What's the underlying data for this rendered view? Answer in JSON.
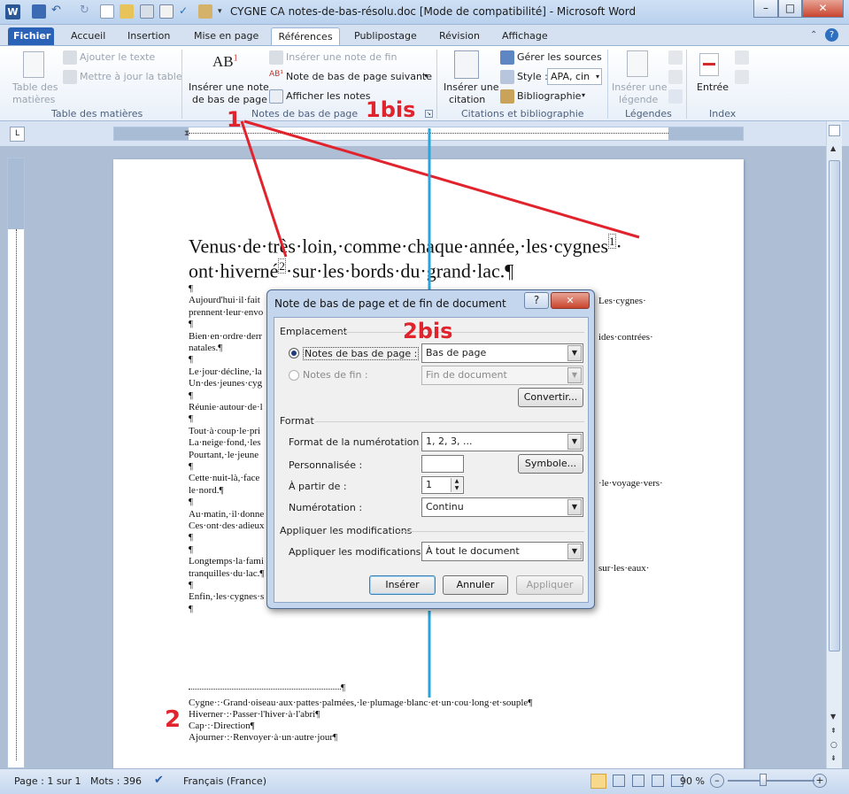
{
  "window": {
    "title": "CYGNE CA notes-de-bas-résolu.doc [Mode de compatibilité]  -  Microsoft Word",
    "minimize": "–",
    "maximize": "□",
    "close": "✕"
  },
  "tabs": [
    "Fichier",
    "Accueil",
    "Insertion",
    "Mise en page",
    "Références",
    "Publipostage",
    "Révision",
    "Affichage"
  ],
  "ribbon": {
    "toc": {
      "big_line1": "Table des",
      "big_line2": "matières",
      "add_text": "Ajouter le texte",
      "update": "Mettre à jour la table",
      "group": "Table des matières"
    },
    "notes": {
      "big_line1": "Insérer une note",
      "big_line2": "de bas de page",
      "ab_label": "AB",
      "ab_sup": "1",
      "insert_endnote": "Insérer une note de fin",
      "next_note": "Note de bas de page suivante",
      "show_notes": "Afficher les notes",
      "group": "Notes de bas de page"
    },
    "citations": {
      "big_line1": "Insérer une",
      "big_line2": "citation",
      "manage": "Gérer les sources",
      "style_label": "Style :",
      "style_value": "APA, cin",
      "biblio": "Bibliographie",
      "group": "Citations et bibliographie"
    },
    "captions": {
      "big_line1": "Insérer une",
      "big_line2": "légende",
      "group": "Légendes"
    },
    "index": {
      "big": "Entrée",
      "group": "Index"
    }
  },
  "document": {
    "line1": "Venus·de·très·loin,·comme·chaque·année,·les·cygnes",
    "sup1": "1",
    "line1_end": "·",
    "line2a": "ont·hiverné",
    "sup2": "2",
    "line2b": "·sur·les·bords·du·grand·lac.¶",
    "left_lines": [
      "¶",
      "Aujourd'hui·il·fait",
      "prennent·leur·envo",
      "¶",
      "Bien·en·ordre·derr",
      "natales.¶",
      "¶",
      "Le·jour·décline,·la",
      "Un·des·jeunes·cyg",
      "¶",
      "Réunie·autour·de·l",
      "¶",
      "Tout·à·coup·le·pri",
      "La·neige·fond,·les",
      "Pourtant,·le·jeune",
      "¶",
      "Cette·nuit-là,·face",
      "le·nord.¶",
      "¶",
      "Au·matin,·il·donne",
      "Ces·ont·des·adieux",
      "¶",
      "¶",
      "Longtemps·la·fami",
      "tranquilles·du·lac.¶",
      "¶",
      "Enfin,·les·cygnes·s",
      "¶"
    ],
    "right_frags": [
      {
        "text": "Les·cygnes·"
      },
      {
        "text": "ides·contrées·"
      },
      {
        "text": "·le·voyage·vers·"
      },
      {
        "text": "sur·les·eaux·"
      }
    ],
    "footnote_sep": "¶",
    "footnotes": [
      "Cygne·:·Grand·oiseau·aux·pattes·palmées,·le·plumage·blanc·et·un·cou·long·et·souple¶",
      "Hiverner·:·Passer·l'hiver·à·l'abri¶",
      "Cap·:·Direction¶",
      "Ajourner·:·Renvoyer·à·un·autre·jour¶"
    ]
  },
  "dialog": {
    "title": "Note de bas de page et de fin de document",
    "help": "?",
    "close": "✕",
    "section_location": "Emplacement",
    "footnotes_label": "Notes de bas de page :",
    "footnotes_value": "Bas de page",
    "endnotes_label": "Notes de fin :",
    "endnotes_value": "Fin de document",
    "convert": "Convertir...",
    "section_format": "Format",
    "numbering_format_label": "Format de la numérotation :",
    "numbering_format_value": "1, 2, 3, ...",
    "custom_label": "Personnalisée :",
    "custom_value": "",
    "symbol": "Symbole...",
    "start_label": "À partir de :",
    "start_value": "1",
    "numbering_label": "Numérotation :",
    "numbering_value": "Continu",
    "section_apply": "Appliquer les modifications",
    "apply_to_label": "Appliquer les modifications à :",
    "apply_to_value": "À tout le document",
    "insert": "Insérer",
    "cancel": "Annuler",
    "apply": "Appliquer"
  },
  "annotations": {
    "a1": "1",
    "a1bis": "1bis",
    "a2": "2",
    "a2bis": "2bis"
  },
  "status": {
    "page": "Page : 1 sur 1",
    "words": "Mots : 396",
    "language": "Français (France)",
    "zoom": "90 %",
    "minus": "–",
    "plus": "+"
  }
}
